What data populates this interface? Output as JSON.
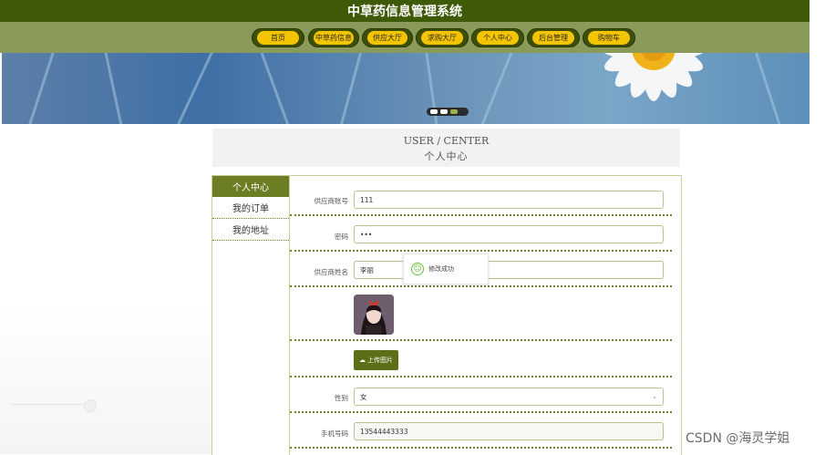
{
  "header": {
    "title": "中草药信息管理系统"
  },
  "nav": {
    "items": [
      {
        "label": "首页"
      },
      {
        "label": "中草药信息"
      },
      {
        "label": "供应大厅"
      },
      {
        "label": "求购大厅"
      },
      {
        "label": "个人中心"
      },
      {
        "label": "后台管理"
      },
      {
        "label": "购物车"
      }
    ]
  },
  "banner": {
    "slide_count": 3,
    "active_slide": 3
  },
  "center": {
    "title_en": "USER / CENTER",
    "title_cn": "个人中心"
  },
  "sidebar": {
    "items": [
      {
        "label": "个人中心",
        "active": true
      },
      {
        "label": "我的订单",
        "active": false
      },
      {
        "label": "我的地址",
        "active": false
      }
    ]
  },
  "form": {
    "supplier_account_label": "供应商账号",
    "supplier_account_value": "111",
    "password_label": "密码",
    "password_value": "•••",
    "supplier_name_label": "供应商姓名",
    "supplier_name_value": "李丽",
    "upload_label": "上传图片",
    "gender_label": "性别",
    "gender_value": "女",
    "phone_label": "手机号码",
    "phone_value": "13544443333"
  },
  "toast": {
    "message": "修改成功"
  },
  "watermark": {
    "text": "CSDN @海灵学姐"
  },
  "colors": {
    "accent_dark": "#3f5a07",
    "nav_bg": "#8a9a5b",
    "pill": "#f5c400",
    "active_side": "#6c7e24",
    "success": "#67c23a"
  }
}
